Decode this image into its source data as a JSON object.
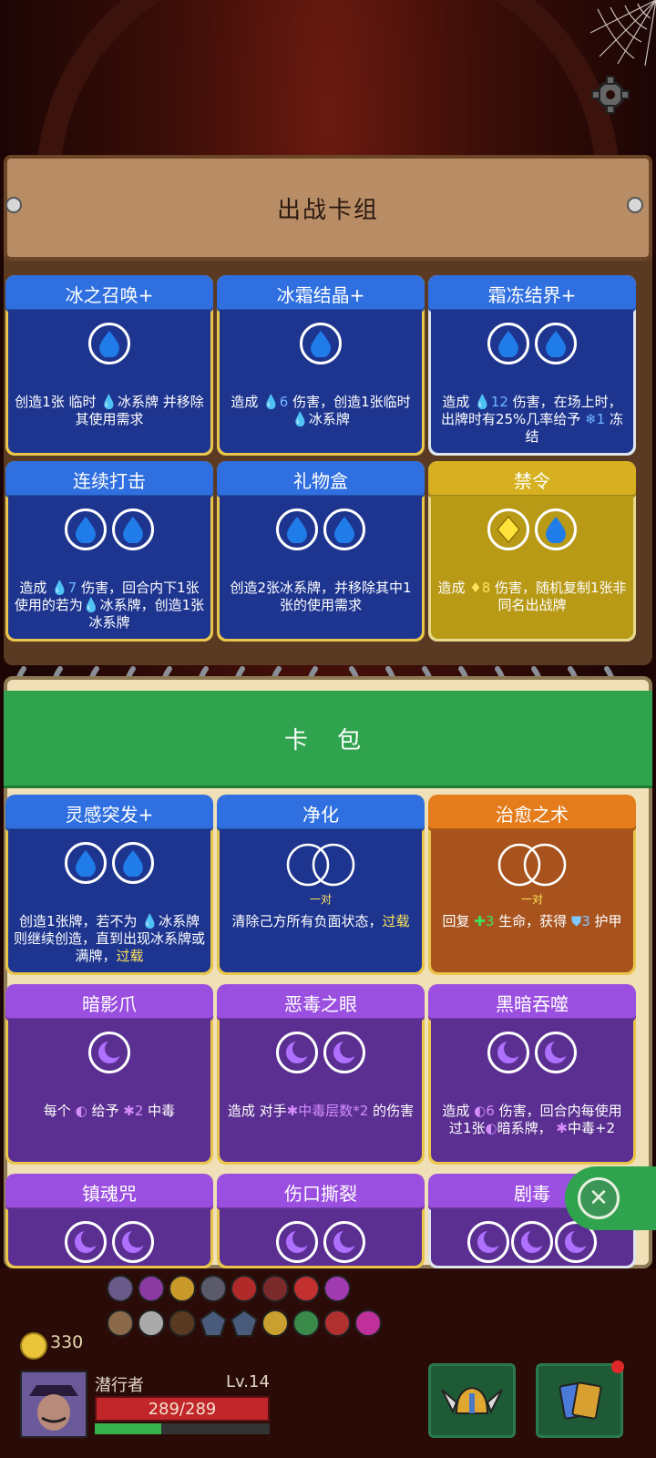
{
  "deck": {
    "title": "出战卡组"
  },
  "pack": {
    "title": "卡 包"
  },
  "deck_cards": [
    {
      "name": "冰之召唤+",
      "desc_a": "创造1张 临时",
      "desc_b": "冰系牌 并移除其使用需求"
    },
    {
      "name": "冰霜结晶+",
      "desc_a": "造成",
      "num": "6",
      "desc_b": "伤害，创造1张临时",
      "desc_c": "冰系牌"
    },
    {
      "name": "霜冻结界+",
      "desc_a": "造成",
      "num": "12",
      "desc_b": "伤害，在场上时，出牌时有25%几率给予",
      "num2": "1",
      "desc_c": "冻结"
    },
    {
      "name": "连续打击",
      "desc_a": "造成",
      "num": "7",
      "desc_b": "伤害，回合内下1张使用的若为",
      "desc_c": "冰系牌，创造1张冰系牌"
    },
    {
      "name": "礼物盒",
      "desc_a": "创造2张冰系牌，并移除其中1张的使用需求"
    },
    {
      "name": "禁令",
      "desc_a": "造成",
      "num": "8",
      "desc_b": "伤害，随机复制1张非同名出战牌"
    }
  ],
  "pack_cards": [
    {
      "name": "灵感突发+",
      "desc_a": "创造1张牌，若不为",
      "desc_b": "冰系牌则继续创造，直到出现冰系牌或满牌，",
      "kw": "过载"
    },
    {
      "name": "净化",
      "sub": "一对",
      "desc_a": "清除己方所有负面状态，",
      "kw": "过载"
    },
    {
      "name": "治愈之术",
      "sub": "一对",
      "desc_a": "回复",
      "num": "3",
      "desc_b": "生命，获得",
      "num2": "3",
      "desc_c": "护甲"
    },
    {
      "name": "暗影爪",
      "desc_a": "每个",
      "desc_b": "给予",
      "num": "2",
      "desc_c": "中毒"
    },
    {
      "name": "恶毒之眼",
      "desc_a": "造成 对手",
      "kw": "中毒层数*2",
      "desc_b": "的伤害"
    },
    {
      "name": "黑暗吞噬",
      "desc_a": "造成",
      "num": "6",
      "desc_b": "伤害，回合内每使用过1张",
      "desc_c": "暗系牌，",
      "desc_d": "中毒+2"
    },
    {
      "name": "镇魂咒"
    },
    {
      "name": "伤口撕裂"
    },
    {
      "name": "剧毒"
    }
  ],
  "player": {
    "gold": "330",
    "name": "潜行者",
    "level": "Lv.14",
    "hp": "289/289",
    "xp_fraction": 0.38
  },
  "colors": {
    "ice": "#1e3590",
    "shadow": "#5a2f91",
    "gold": "#b89a17",
    "heal": "#a8531d",
    "pack_green": "#2fa34d"
  },
  "icons": [
    "gear-icon",
    "water-drop-icon",
    "moon-icon",
    "diamond-icon",
    "close-icon",
    "coin-icon",
    "helmet-icon",
    "cards-icon"
  ]
}
